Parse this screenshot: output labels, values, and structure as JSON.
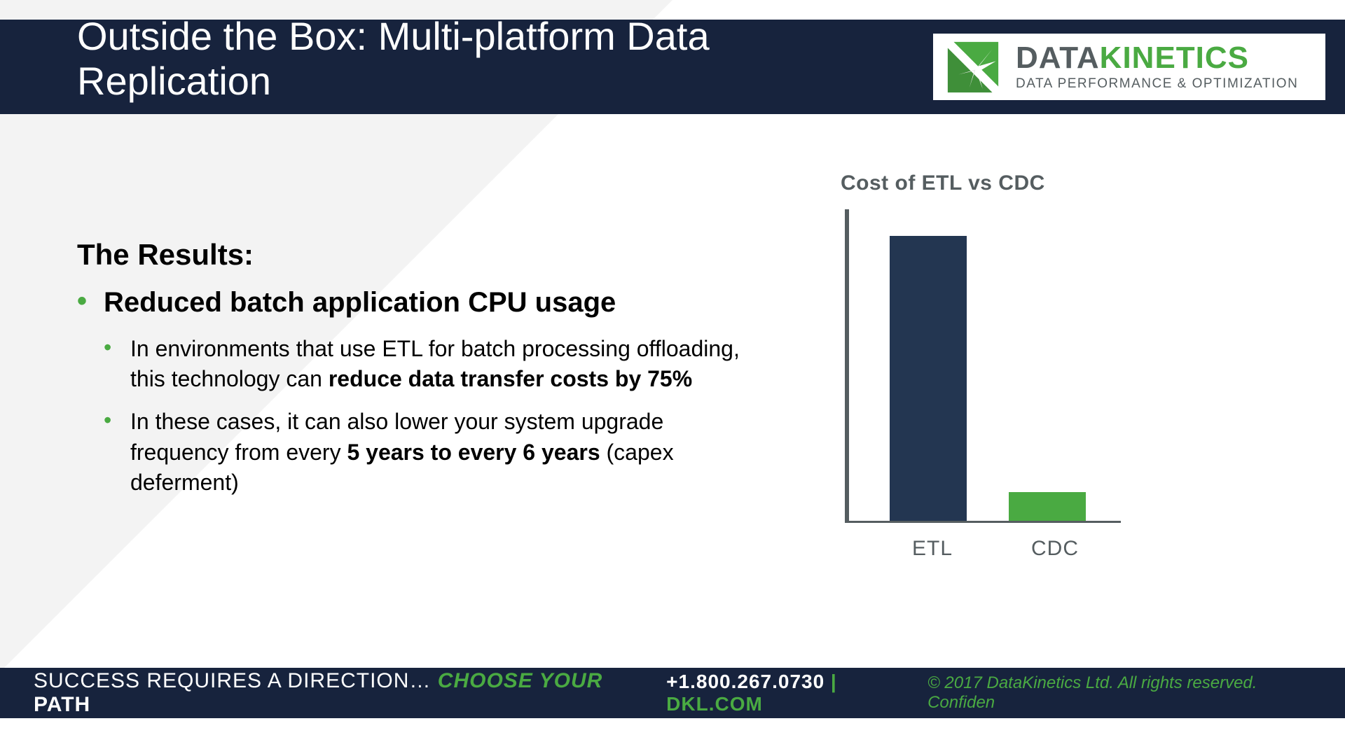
{
  "header": {
    "title": "Outside the Box: Multi-platform Data Replication"
  },
  "logo": {
    "word_left": "DATA",
    "word_right": "KINETICS",
    "tagline": "DATA PERFORMANCE & OPTIMIZATION"
  },
  "body": {
    "heading": "The Results:",
    "bullet1": "Reduced batch application CPU usage",
    "sub1_pre": "In environments that use ETL for batch processing offloading, this technology can ",
    "sub1_bold": "reduce data transfer costs by 75%",
    "sub2_pre": "In these cases, it can also lower your system upgrade frequency from every ",
    "sub2_bold": "5 years to every 6 years",
    "sub2_post": " (capex deferment)"
  },
  "chart_data": {
    "type": "bar",
    "title": "Cost of ETL vs CDC",
    "categories": [
      "ETL",
      "CDC"
    ],
    "values": [
      100,
      10
    ],
    "colors": [
      "#233651",
      "#4aaa42"
    ],
    "xlabel": "",
    "ylabel": "",
    "ylim": [
      0,
      110
    ]
  },
  "footer": {
    "tagline_pre": "SUCCESS REQUIRES A DIRECTION… ",
    "tagline_choose": "CHOOSE YOUR ",
    "tagline_path": "PATH",
    "phone": "+1.800.267.0730",
    "sep": "  |  ",
    "site": "DKL.COM",
    "copyright": "© 2017 DataKinetics Ltd.   All rights reserved. Confiden"
  }
}
